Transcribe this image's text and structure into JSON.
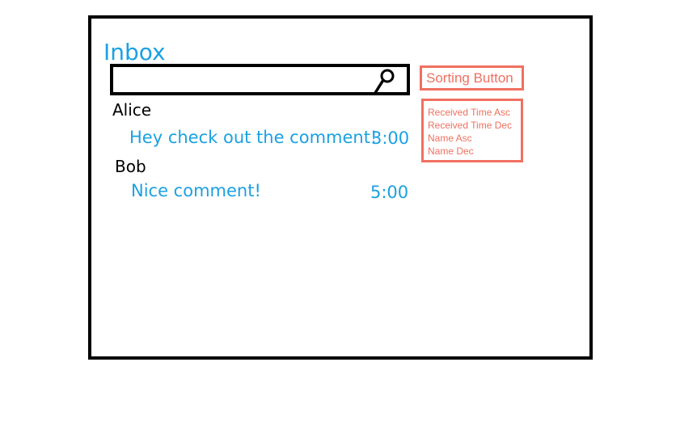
{
  "header": {
    "title": "Inbox"
  },
  "search": {
    "value": "",
    "icon": "search-icon"
  },
  "messages": [
    {
      "sender": "Alice",
      "text": "Hey check out the comment!",
      "time": "3:00"
    },
    {
      "sender": "Bob",
      "text": "Nice comment!",
      "time": "5:00"
    }
  ],
  "sort": {
    "button_label": "Sorting Button",
    "options": [
      "Received Time Asc",
      "Received Time Dec",
      "Name Asc",
      "Name Dec"
    ]
  },
  "colors": {
    "title": "#1ba1e2",
    "message": "#1ba1e2",
    "sort_accent": "#f07060",
    "frame": "#000000"
  }
}
